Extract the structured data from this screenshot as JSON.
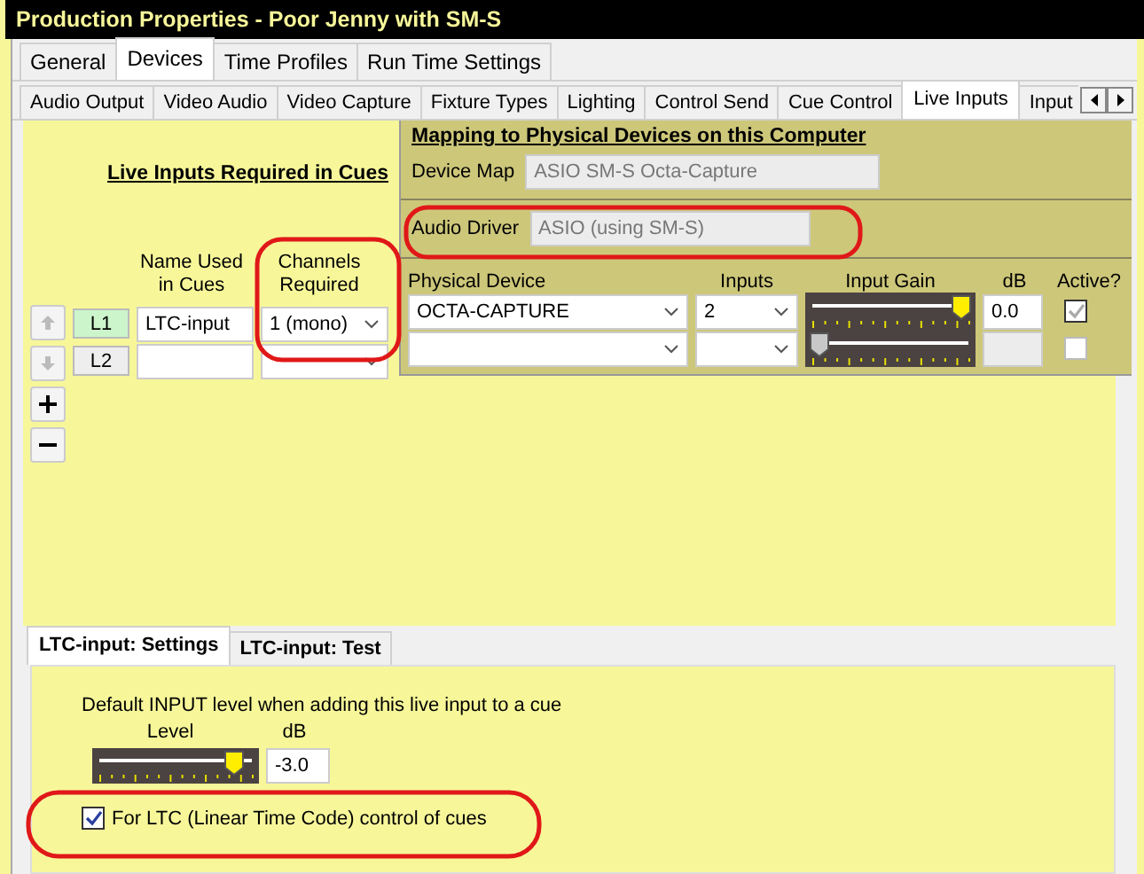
{
  "window": {
    "title": "Production Properties - Poor Jenny with SM-S"
  },
  "tabs": [
    {
      "label": "General",
      "selected": false
    },
    {
      "label": "Devices",
      "selected": true
    },
    {
      "label": "Time Profiles",
      "selected": false
    },
    {
      "label": "Run Time Settings",
      "selected": false
    }
  ],
  "subtabs": [
    {
      "label": "Audio Output",
      "selected": false
    },
    {
      "label": "Video Audio",
      "selected": false
    },
    {
      "label": "Video Capture",
      "selected": false
    },
    {
      "label": "Fixture Types",
      "selected": false
    },
    {
      "label": "Lighting",
      "selected": false
    },
    {
      "label": "Control Send",
      "selected": false
    },
    {
      "label": "Cue Control",
      "selected": false
    },
    {
      "label": "Live Inputs",
      "selected": true
    },
    {
      "label": "Input",
      "selected": false
    }
  ],
  "live_inputs": {
    "heading": "Live Inputs Required in Cues",
    "name_header": "Name Used in Cues",
    "channels_header": "Channels Required",
    "rows": [
      {
        "label": "L1",
        "selected": true,
        "name": "LTC-input",
        "channels": "1 (mono)"
      },
      {
        "label": "L2",
        "selected": false
      }
    ]
  },
  "mapping": {
    "heading": "Mapping to Physical Devices on this Computer",
    "device_map_label": "Device Map",
    "device_map": "ASIO SM-S Octa-Capture",
    "audio_driver_label": "Audio Driver",
    "audio_driver": "ASIO (using SM-S)",
    "columns": [
      "Physical Device",
      "Inputs",
      "Input Gain",
      "dB",
      "Active?"
    ],
    "rows": [
      {
        "device": "OCTA-CAPTURE",
        "inputs": "2",
        "level": 0.97,
        "db": "0.0",
        "active": true,
        "disabled": false
      },
      {
        "level": 0,
        "active": false,
        "disabled": true
      }
    ]
  },
  "bottom_tabs": [
    {
      "label": "LTC-input: Settings",
      "selected": true
    },
    {
      "label": "LTC-input: Test",
      "selected": false
    }
  ],
  "settings": {
    "description": "Default INPUT level when adding this live input to a cue",
    "level_label": "Level",
    "db_label": "dB",
    "level": 0.9,
    "db": "-3.0",
    "ltc_label": "For LTC (Linear Time Code) control of cues",
    "ltc_checked": true
  }
}
